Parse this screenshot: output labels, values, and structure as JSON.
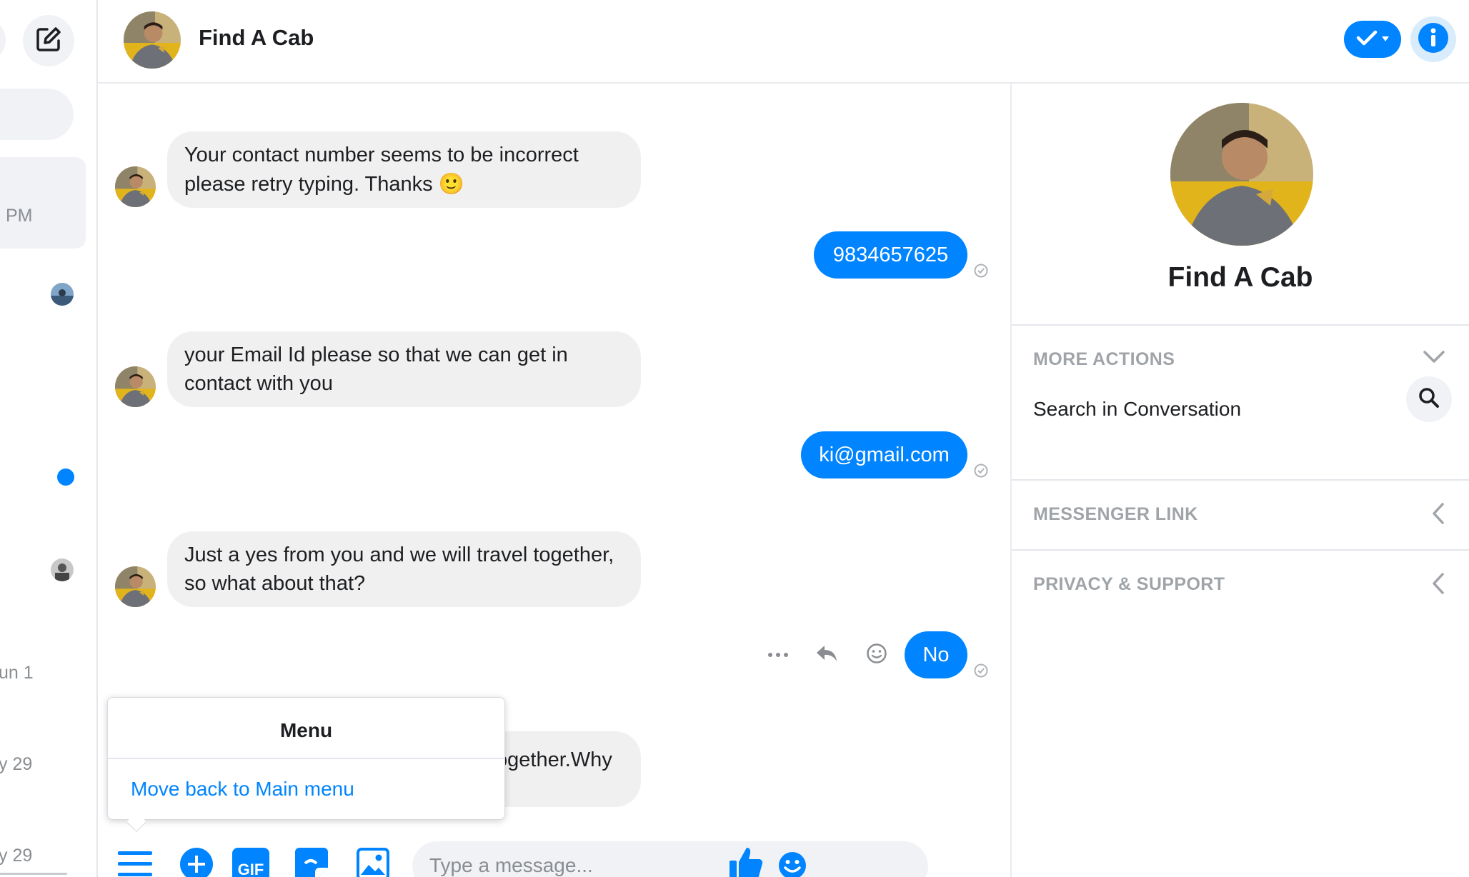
{
  "sidebar": {
    "times": [
      "PM",
      "un 1",
      "y 29",
      "y 29"
    ]
  },
  "header": {
    "title": "Find A Cab"
  },
  "conversation": {
    "messages": [
      {
        "from": "bot",
        "text": "Your contact number seems to be incorrect please retry typing. Thanks",
        "emoji": "🙂"
      },
      {
        "from": "me",
        "text": "9834657625"
      },
      {
        "from": "bot",
        "text": "your Email Id please so that we can get in contact with you"
      },
      {
        "from": "me",
        "text": "ki@gmail.com"
      },
      {
        "from": "bot",
        "text": "Just a yes from you and we will travel together, so what about that?"
      },
      {
        "from": "me",
        "text": "No"
      },
      {
        "from": "bot",
        "text": "ogether.Why"
      }
    ]
  },
  "menu_popup": {
    "title": "Menu",
    "item": "Move back to Main menu"
  },
  "composer": {
    "placeholder": "Type a message...",
    "gif_label": "GIF"
  },
  "info_panel": {
    "name": "Find A Cab",
    "more_actions": "MORE ACTIONS",
    "search_label": "Search in Conversation",
    "messenger_link": "MESSENGER LINK",
    "privacy_support": "PRIVACY & SUPPORT"
  },
  "colors": {
    "accent": "#0084ff",
    "bubble_in": "#f0f0f0",
    "muted": "#a0a4a8"
  },
  "icons": [
    "compose-icon",
    "check-icon",
    "info-icon",
    "more-icon",
    "reply-icon",
    "emoji-icon",
    "menu-icon",
    "plus-icon",
    "gif-icon",
    "sticker-icon",
    "image-icon",
    "like-icon",
    "search-icon",
    "chevron-down-icon",
    "chevron-left-icon",
    "seen-icon"
  ]
}
